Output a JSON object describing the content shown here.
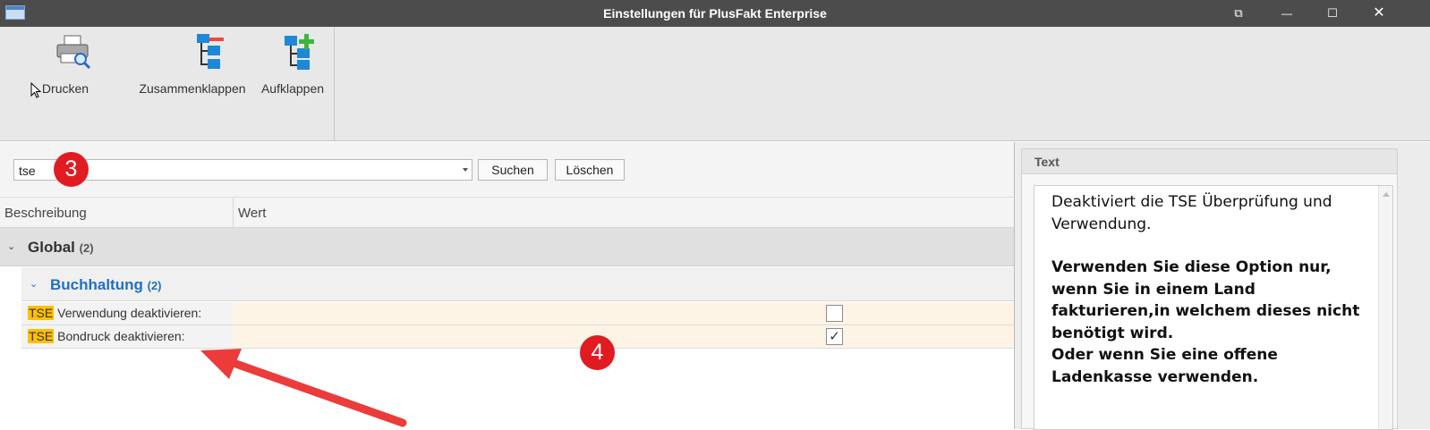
{
  "window": {
    "title": "Einstellungen für PlusFakt Enterprise",
    "controls": {
      "restore": "⧉",
      "minimize": "—",
      "maximize": "☐",
      "close": "✕"
    }
  },
  "toolbar": {
    "print_label": "Drucken",
    "collapse_label": "Zusammenklappen",
    "expand_label": "Aufklappen"
  },
  "search": {
    "value": "tse",
    "search_button": "Suchen",
    "clear_button": "Löschen"
  },
  "grid": {
    "columns": [
      "Beschreibung",
      "Wert"
    ],
    "groups": [
      {
        "name": "Global",
        "count": "(2)"
      },
      {
        "name": "Buchhaltung",
        "count": "(2)"
      }
    ],
    "rows": [
      {
        "highlight": "TSE",
        "label": " Verwendung deaktivieren:",
        "checked": false,
        "check_glyph": ""
      },
      {
        "highlight": "TSE",
        "label": " Bondruck deaktivieren:",
        "checked": true,
        "check_glyph": "✓"
      }
    ]
  },
  "text_panel": {
    "header": "Text",
    "description": "Deaktiviert die TSE Überprüfung und Verwendung.",
    "warning": "Verwenden Sie diese Option nur, wenn Sie in einem Land fakturieren,in welchem dieses nicht benötigt wird.\nOder wenn Sie eine offene Ladenkasse verwenden."
  },
  "annotations": {
    "marker3": "3",
    "marker4": "4",
    "accent": "#e01c22"
  },
  "icons": [
    "printer-icon",
    "collapse-tree-icon",
    "expand-tree-icon",
    "chevron-down-icon",
    "cursor-icon"
  ]
}
